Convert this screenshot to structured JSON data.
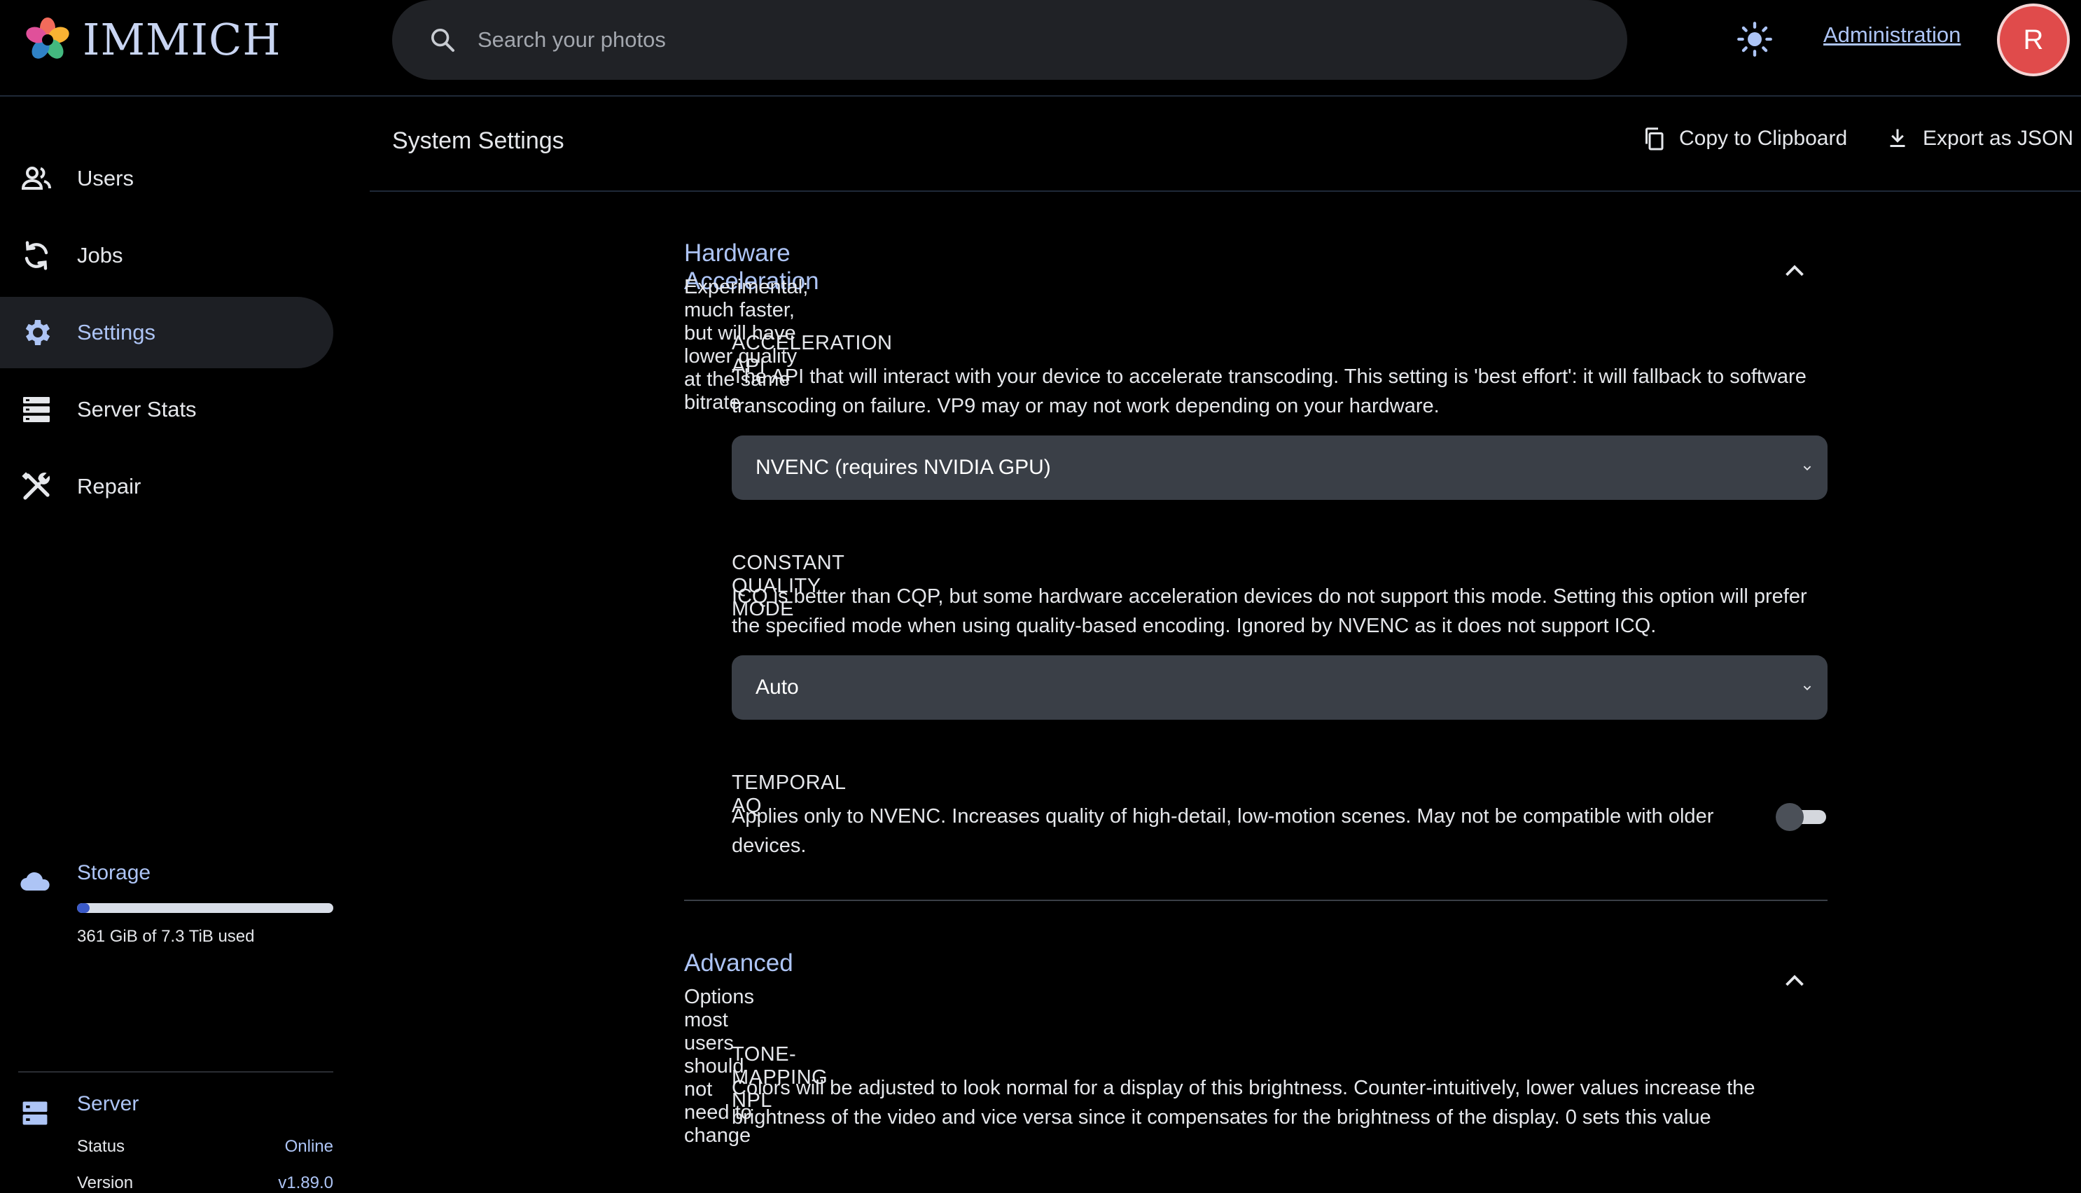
{
  "app": {
    "name": "IMMICH"
  },
  "search": {
    "placeholder": "Search your photos"
  },
  "header": {
    "admin_link": "Administration",
    "avatar_initial": "R"
  },
  "sidebar": {
    "items": [
      {
        "label": "Users",
        "icon": "users-icon"
      },
      {
        "label": "Jobs",
        "icon": "sync-icon"
      },
      {
        "label": "Settings",
        "icon": "gear-icon",
        "active": true
      },
      {
        "label": "Server Stats",
        "icon": "server-stats-icon"
      },
      {
        "label": "Repair",
        "icon": "tools-icon"
      }
    ],
    "storage": {
      "title": "Storage",
      "used_text": "361 GiB of 7.3 TiB used",
      "fraction": 0.048
    },
    "server": {
      "title": "Server",
      "status_label": "Status",
      "status_value": "Online",
      "version_label": "Version",
      "version_value": "v1.89.0"
    }
  },
  "main": {
    "title": "System Settings",
    "copy_label": "Copy to Clipboard",
    "export_label": "Export as JSON"
  },
  "hw": {
    "title": "Hardware Acceleration",
    "subtitle": "Experimental; much faster, but will have lower quality at the same bitrate",
    "api": {
      "label": "ACCELERATION API",
      "desc": "The API that will interact with your device to accelerate transcoding. This setting is 'best effort': it will fallback to software transcoding on failure. VP9 may or may not work depending on your hardware.",
      "value": "NVENC (requires NVIDIA GPU)"
    },
    "cq": {
      "label": "CONSTANT QUALITY MODE",
      "desc": "ICQ is better than CQP, but some hardware acceleration devices do not support this mode. Setting this option will prefer the specified mode when using quality-based encoding. Ignored by NVENC as it does not support ICQ.",
      "value": "Auto"
    },
    "taq": {
      "label": "TEMPORAL AQ",
      "desc": "Applies only to NVENC. Increases quality of high-detail, low-motion scenes. May not be compatible with older devices.",
      "enabled": false
    }
  },
  "adv": {
    "title": "Advanced",
    "subtitle": "Options most users should not need to change",
    "tone": {
      "label": "TONE-MAPPING NPL",
      "desc": "Colors will be adjusted to look normal for a display of this brightness. Counter-intuitively, lower values increase the brightness of the video and vice versa since it compensates for the brightness of the display. 0 sets this value"
    }
  },
  "colors": {
    "accent": "#adc4f5",
    "background": "#000000",
    "select_bg": "#3a3f47",
    "avatar": "#e04b4b"
  }
}
